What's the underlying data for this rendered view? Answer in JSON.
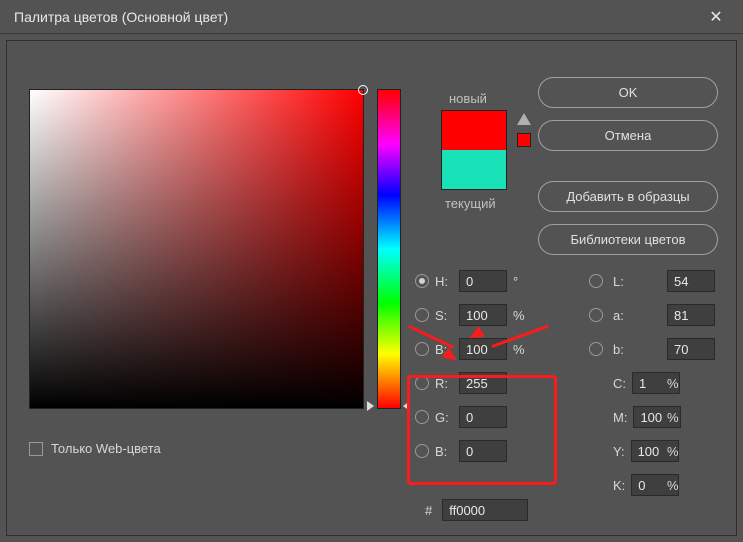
{
  "title": "Палитра цветов (Основной цвет)",
  "close": "✕",
  "swatches": {
    "new_label": "новый",
    "current_label": "текущий"
  },
  "buttons": {
    "ok": "OK",
    "cancel": "Отмена",
    "add_to_swatches": "Добавить в образцы",
    "color_libraries": "Библиотеки цветов"
  },
  "hsb": {
    "h": {
      "label": "H:",
      "value": "0",
      "unit": "°"
    },
    "s": {
      "label": "S:",
      "value": "100",
      "unit": "%"
    },
    "b": {
      "label": "B:",
      "value": "100",
      "unit": "%"
    }
  },
  "lab": {
    "l": {
      "label": "L:",
      "value": "54"
    },
    "a": {
      "label": "a:",
      "value": "81"
    },
    "b": {
      "label": "b:",
      "value": "70"
    }
  },
  "rgb": {
    "r": {
      "label": "R:",
      "value": "255"
    },
    "g": {
      "label": "G:",
      "value": "0"
    },
    "b": {
      "label": "B:",
      "value": "0"
    }
  },
  "cmyk": {
    "c": {
      "label": "C:",
      "value": "1",
      "unit": "%"
    },
    "m": {
      "label": "M:",
      "value": "100",
      "unit": "%"
    },
    "y": {
      "label": "Y:",
      "value": "100",
      "unit": "%"
    },
    "k": {
      "label": "K:",
      "value": "0",
      "unit": "%"
    }
  },
  "hex": {
    "label": "#",
    "value": "ff0000"
  },
  "web_only": {
    "label": "Только Web-цвета"
  },
  "colors": {
    "new": "#ff0000",
    "current": "#19e2b9",
    "highlight": "#ff1a1a"
  }
}
